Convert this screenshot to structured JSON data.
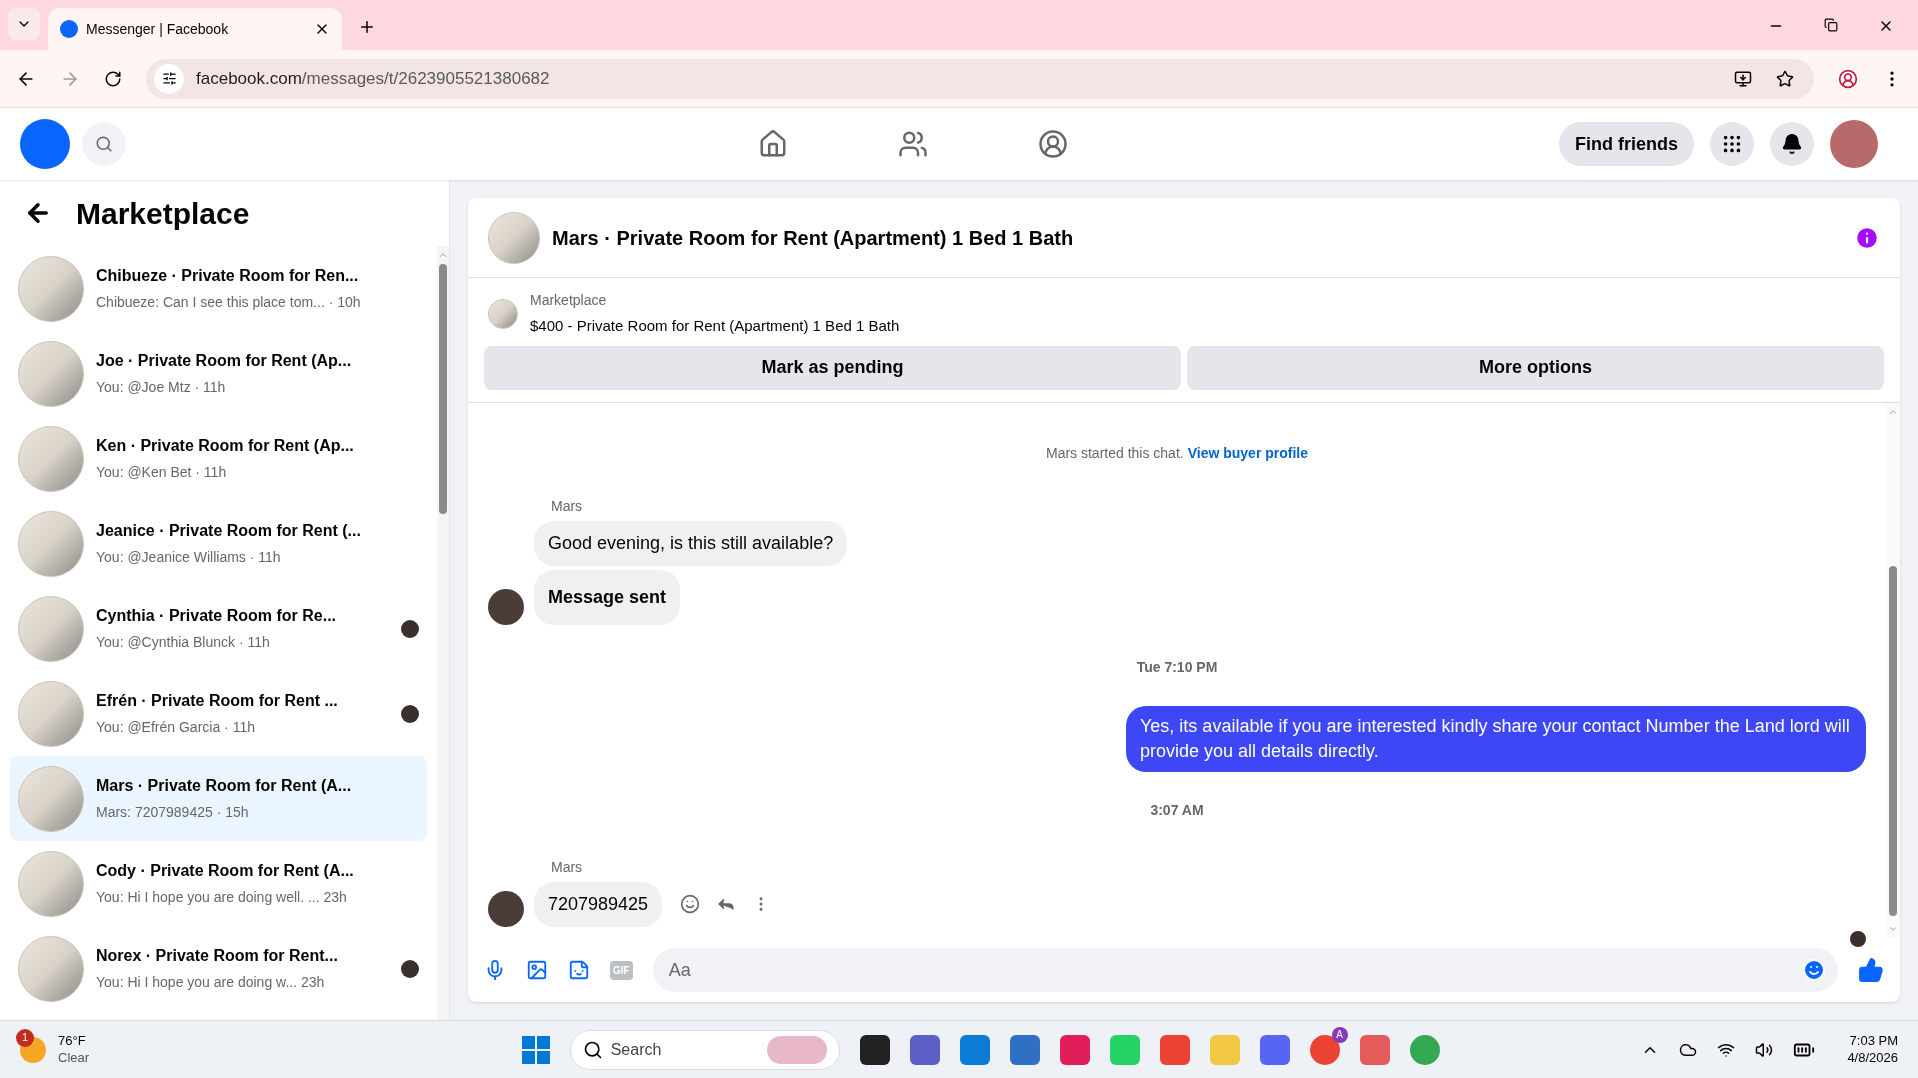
{
  "browser": {
    "tab_title": "Messenger | Facebook",
    "url_domain": "facebook.com",
    "url_path": "/messages/t/2623905521380682"
  },
  "header": {
    "find_friends": "Find friends"
  },
  "sidebar": {
    "title": "Marketplace",
    "conversations": [
      {
        "title": "Chibueze · Private Room for Ren...",
        "subtitle": "Chibueze: Can I see this place tom... · 10h",
        "selected": false,
        "seen": false
      },
      {
        "title": "Joe · Private Room for Rent (Ap...",
        "subtitle": "You: @Joe Mtz · 11h",
        "selected": false,
        "seen": false
      },
      {
        "title": "Ken · Private Room for Rent (Ap...",
        "subtitle": "You: @Ken Bet · 11h",
        "selected": false,
        "seen": false
      },
      {
        "title": "Jeanice · Private Room for Rent (...",
        "subtitle": "You: @Jeanice Williams · 11h",
        "selected": false,
        "seen": false
      },
      {
        "title": "Cynthia · Private Room for Re...",
        "subtitle": "You: @Cynthia Blunck · 11h",
        "selected": false,
        "seen": true
      },
      {
        "title": "Efrén · Private Room for Rent ...",
        "subtitle": "You: @Efrén Garcia · 11h",
        "selected": false,
        "seen": true
      },
      {
        "title": "Mars · Private Room for Rent (A...",
        "subtitle": "Mars: 7207989425 · 15h",
        "selected": true,
        "seen": false
      },
      {
        "title": "Cody · Private Room for Rent (A...",
        "subtitle": "You: Hi I hope you are doing well. ...  23h",
        "selected": false,
        "seen": false
      },
      {
        "title": "Norex · Private Room for Rent...",
        "subtitle": "You: Hi I hope you are doing w... 23h",
        "selected": false,
        "seen": true
      }
    ]
  },
  "chat": {
    "title": "Mars · Private Room for Rent (Apartment) 1 Bed 1 Bath",
    "listing": {
      "label": "Marketplace",
      "text": "$400 - Private Room for Rent (Apartment) 1 Bed 1 Bath"
    },
    "actions": [
      "Mark as pending",
      "More options"
    ],
    "messages": [
      {
        "kind": "system",
        "text": "Mars started this chat.",
        "link": "View buyer profile"
      },
      {
        "kind": "sender",
        "text": "Mars"
      },
      {
        "kind": "incoming",
        "text": "Good evening, is this still available?",
        "emphasis": false,
        "avatar": false
      },
      {
        "kind": "incoming",
        "text": "Message sent",
        "emphasis": true,
        "avatar": true
      },
      {
        "kind": "timestamp",
        "text": "Tue 7:10 PM"
      },
      {
        "kind": "outgoing",
        "text": "Yes, its available if you are interested kindly share your contact Number the Land lord will provide you all details directly."
      },
      {
        "kind": "timestamp",
        "text": "3:07 AM"
      },
      {
        "kind": "sender",
        "text": "Mars"
      },
      {
        "kind": "incoming",
        "text": "7207989425",
        "emphasis": false,
        "avatar": true,
        "actions": true
      }
    ],
    "composer": {
      "placeholder": "Aa",
      "gif_label": "GIF"
    }
  },
  "taskbar": {
    "weather_badge": "1",
    "temperature": "76°F",
    "condition": "Clear",
    "search": "Search",
    "profile_badge": "A",
    "time": "7:03 PM",
    "date": "4/8/2026"
  }
}
